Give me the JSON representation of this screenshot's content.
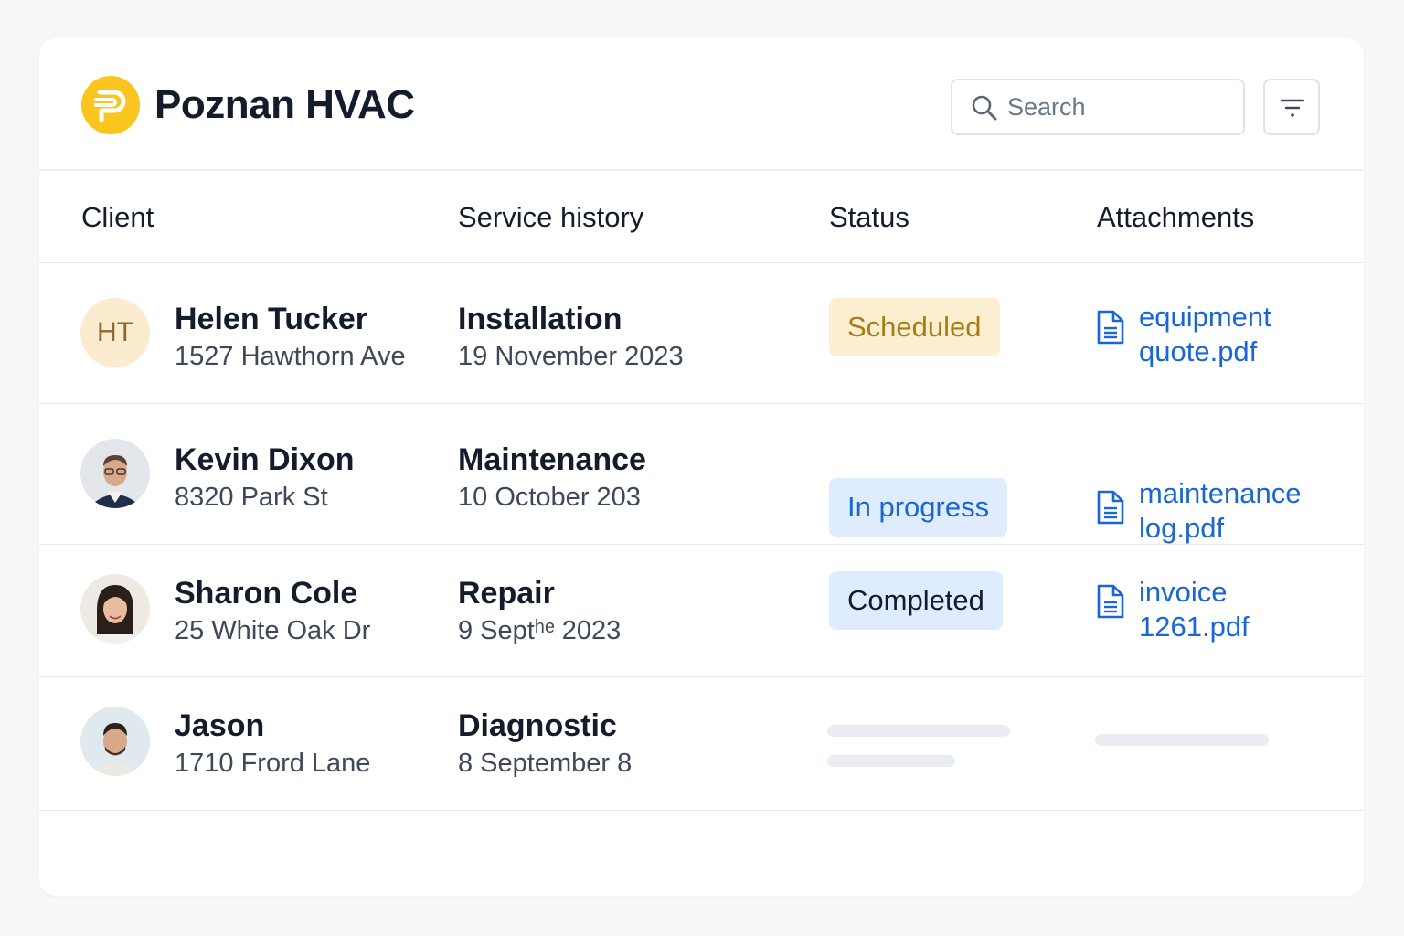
{
  "app": {
    "title": "Poznan HVAC"
  },
  "search": {
    "placeholder": "Search"
  },
  "columns": {
    "client": "Client",
    "service": "Service history",
    "status": "Status",
    "attachments": "Attachments"
  },
  "colors": {
    "accent": "#1a66d6",
    "logo": "#f9c51e",
    "scheduled_bg": "#fbefcf",
    "scheduled_text": "#a77b16",
    "progress_bg": "#dfecfd"
  },
  "rows": [
    {
      "initials": "HT",
      "name": "Helen Tucker",
      "address": "1527 Hawthorn Ave",
      "service": "Installation",
      "date": "19 November 2023",
      "status": "Scheduled",
      "file_line1": "equipment",
      "file_line2": "quote.pdf"
    },
    {
      "name": "Kevin Dixon",
      "address": "8320 Park St",
      "service": "Maintenance",
      "date": "10 October 203",
      "status": "In progress",
      "file_line1": "maintenance",
      "file_line2": "log.pdf"
    },
    {
      "name": "Sharon Cole",
      "address": "25 White Oak Dr",
      "service": "Repair",
      "date": "9 Septʰᵉ 2023",
      "status": "Completed",
      "file_line1": "invoice",
      "file_line2": "1261.pdf"
    },
    {
      "name": "Jason",
      "address": "1710 Frord Lane",
      "service": "Diagnostic",
      "date": "8 September 8"
    }
  ]
}
